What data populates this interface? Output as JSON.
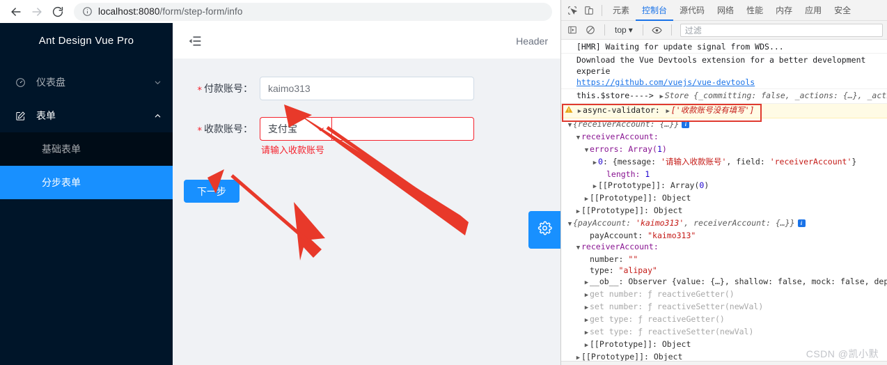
{
  "browser": {
    "back_icon": "arrow-left-icon",
    "forward_icon": "arrow-right-icon",
    "reload_icon": "reload-icon",
    "info_icon": "info-circle-icon",
    "url_host": "localhost:8080",
    "url_path": "/form/step-form/info"
  },
  "sidebar": {
    "brand": "Ant Design Vue Pro",
    "items": [
      {
        "label": "仪表盘",
        "icon": "dashboard-icon",
        "arrow": "chevron-down-icon",
        "open": false
      },
      {
        "label": "表单",
        "icon": "form-edit-icon",
        "arrow": "chevron-up-icon",
        "open": true
      }
    ],
    "submenu": [
      {
        "label": "基础表单",
        "active": false
      },
      {
        "label": "分步表单",
        "active": true
      }
    ]
  },
  "topbar": {
    "fold_icon": "menu-fold-icon",
    "header_text": "Header"
  },
  "form": {
    "pay_account": {
      "label": "付款账号：",
      "required_mark": "*",
      "value": "kaimo313"
    },
    "receiver_account": {
      "label": "收款账号：",
      "required_mark": "*",
      "select_value": "支付宝",
      "select_caret": "chevron-down-icon",
      "number_value": "",
      "error": "请输入收款账号"
    },
    "next_button": "下一步",
    "setting_button_icon": "gear-icon"
  },
  "devtools": {
    "icons": {
      "inspect": "inspect-element-icon",
      "device": "device-toolbar-icon",
      "sidebar_toggle": "console-sidebar-icon",
      "clear": "clear-console-icon",
      "eye": "eye-icon"
    },
    "tabs": [
      {
        "label": "元素",
        "active": false
      },
      {
        "label": "控制台",
        "active": true
      },
      {
        "label": "源代码",
        "active": false
      },
      {
        "label": "网络",
        "active": false
      },
      {
        "label": "性能",
        "active": false
      },
      {
        "label": "内存",
        "active": false
      },
      {
        "label": "应用",
        "active": false
      },
      {
        "label": "安全",
        "active": false
      }
    ],
    "context": "top",
    "context_caret": "chevron-down-icon",
    "filter_placeholder": "过滤",
    "console_lines": {
      "hmr": "[HMR] Waiting for update signal from WDS...",
      "devtools_hint": "Download the Vue Devtools extension for a better development experie",
      "devtools_link": "https://github.com/vuejs/vue-devtools",
      "store_label": "this.$store---->",
      "store_value": "Store {_committing: false, _actions: {…}, _action",
      "warn_label": "async-validator:",
      "warn_value": "['收款账号没有填写']"
    },
    "object_tree": [
      {
        "indent": 0,
        "tri": "▼",
        "text": "{receiverAccount: {…}}",
        "style": "italic-gray",
        "badge": true
      },
      {
        "indent": 1,
        "tri": "▼",
        "text": "receiverAccount:",
        "style": "prop"
      },
      {
        "indent": 2,
        "tri": "▼",
        "text": "errors: Array(1)",
        "style": "prop-array"
      },
      {
        "indent": 3,
        "tri": "▶",
        "text": "0: {message: '请输入收款账号', field: 'receiverAccount'}",
        "style": "entry"
      },
      {
        "indent": 4,
        "tri": "",
        "text": "length: 1",
        "style": "length"
      },
      {
        "indent": 3,
        "tri": "▶",
        "text": "[[Prototype]]: Array(0)",
        "style": "proto"
      },
      {
        "indent": 2,
        "tri": "▶",
        "text": "[[Prototype]]: Object",
        "style": "proto"
      },
      {
        "indent": 1,
        "tri": "▶",
        "text": "[[Prototype]]: Object",
        "style": "proto"
      },
      {
        "indent": 0,
        "tri": "▼",
        "text": "{payAccount: 'kaimo313', receiverAccount: {…}}",
        "style": "italic-gray",
        "badge": true
      },
      {
        "indent": 2,
        "tri": "",
        "text": "payAccount: \"kaimo313\"",
        "style": "entry"
      },
      {
        "indent": 1,
        "tri": "▼",
        "text": "receiverAccount:",
        "style": "prop"
      },
      {
        "indent": 2,
        "tri": "",
        "text": "number: \"\"",
        "style": "entry"
      },
      {
        "indent": 2,
        "tri": "",
        "text": "type: \"alipay\"",
        "style": "entry"
      },
      {
        "indent": 2,
        "tri": "▶",
        "text": "__ob__: Observer {value: {…}, shallow: false, mock: false, dep",
        "style": "entry-dim"
      },
      {
        "indent": 2,
        "tri": "▶",
        "text": "get number: ƒ reactiveGetter()",
        "style": "getter"
      },
      {
        "indent": 2,
        "tri": "▶",
        "text": "set number: ƒ reactiveSetter(newVal)",
        "style": "getter"
      },
      {
        "indent": 2,
        "tri": "▶",
        "text": "get type: ƒ reactiveGetter()",
        "style": "getter"
      },
      {
        "indent": 2,
        "tri": "▶",
        "text": "set type: ƒ reactiveSetter(newVal)",
        "style": "getter"
      },
      {
        "indent": 2,
        "tri": "▶",
        "text": "[[Prototype]]: Object",
        "style": "proto"
      },
      {
        "indent": 1,
        "tri": "▶",
        "text": "[[Prototype]]: Object",
        "style": "proto"
      }
    ],
    "watermark": "CSDN @凯小默"
  },
  "colors": {
    "accent_blue": "#1890ff",
    "sidebar_bg": "#001529",
    "submenu_bg": "#000c17",
    "error_red": "#f5222d",
    "annotation_red": "#e8392a",
    "devtools_active": "#1a73e8"
  }
}
